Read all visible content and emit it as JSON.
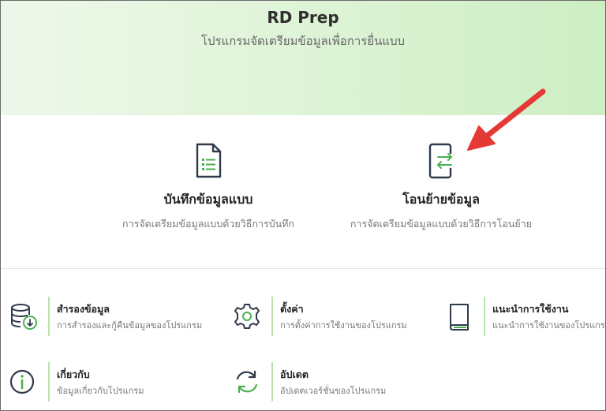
{
  "header": {
    "title": "RD Prep",
    "subtitle": "โปรแกรมจัดเตรียมข้อมูลเพื่อการยื่นแบบ"
  },
  "main_options": [
    {
      "title": "บันทึกข้อมูลแบบ",
      "description": "การจัดเตรียมข้อมูลแบบด้วยวิธีการบันทึก",
      "icon": "document-list-icon"
    },
    {
      "title": "โอนย้ายข้อมูล",
      "description": "การจัดเตรียมข้อมูลแบบด้วยวิธีการโอนย้าย",
      "icon": "transfer-device-icon"
    }
  ],
  "tiles": [
    {
      "title": "สำรองข้อมูล",
      "description": "การสำรองและกู้คืนข้อมูลของโปรแกรม",
      "icon": "database-backup-icon"
    },
    {
      "title": "ตั้งค่า",
      "description": "การตั้งค่าการใช้งานของโปรแกรม",
      "icon": "gear-icon"
    },
    {
      "title": "แนะนำการใช้งาน",
      "description": "แนะนำการใช้งานของโปรแกรม",
      "icon": "book-icon"
    },
    {
      "title": "เกี่ยวกับ",
      "description": "ข้อมูลเกี่ยวกับโปรแกรม",
      "icon": "info-icon"
    },
    {
      "title": "อัปเดต",
      "description": "อัปเดตเวอร์ชั่นของโปรแกรม",
      "icon": "refresh-icon"
    }
  ],
  "colors": {
    "accent_green": "#4caf50",
    "annotation_red": "#e53935",
    "icon_dark": "#2f3b4a"
  }
}
